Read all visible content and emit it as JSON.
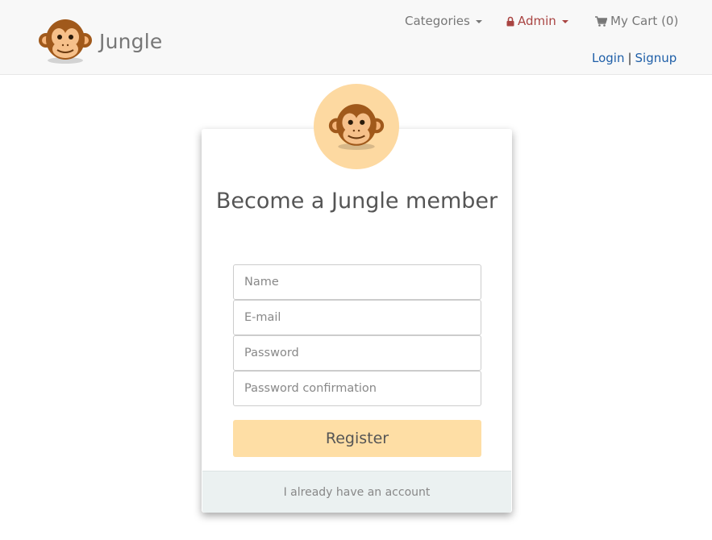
{
  "brand": {
    "name": "Jungle",
    "logo_icon": "monkey-logo-icon"
  },
  "nav": {
    "categories_label": "Categories",
    "admin_label": "Admin",
    "cart_label": "My Cart (0)",
    "login_label": "Login",
    "separator": "|",
    "signup_label": "Signup"
  },
  "colors": {
    "navbar_bg": "#f8f8f8",
    "admin": "#a94442",
    "link": "#1f5fa8",
    "accent": "#fedea5",
    "avatar_bg": "#fdd9a1",
    "footer_bg": "#ebf1f1"
  },
  "form": {
    "title": "Become a Jungle member",
    "name_placeholder": "Name",
    "email_placeholder": "E-mail",
    "password_placeholder": "Password",
    "password_confirmation_placeholder": "Password confirmation",
    "register_label": "Register",
    "footer_link": "I already have an account"
  }
}
